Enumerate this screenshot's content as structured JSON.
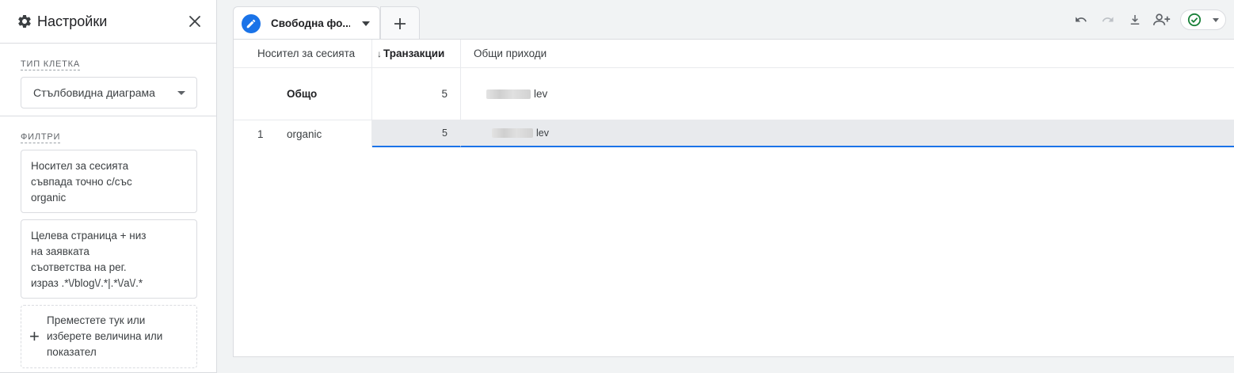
{
  "settings": {
    "title": "Настройки",
    "cell_type_label": "ТИП КЛЕТКА",
    "cell_type_value": "Стълбовидна диаграма",
    "filters_label": "ФИЛТРИ",
    "filters": [
      "Носител за сесията\nсъвпада точно с/със\norganic",
      "Целева страница + низ\nна заявката\nсъответства на рег.\nизраз .*\\/blog\\/.*|.*\\/a\\/.*"
    ],
    "drop_zone_text": "Преместете тук или\nизберете величина или\nпоказател"
  },
  "tab": {
    "label": "Свободна фо..."
  },
  "table": {
    "columns": [
      "Носител за сесията",
      "Транзакции",
      "Общи приходи"
    ],
    "sort_arrow": "↓",
    "total": {
      "label": "Общо",
      "transactions": "5",
      "revenue_suffix": "lev"
    },
    "rows": [
      {
        "index": "1",
        "medium": "organic",
        "transactions": "5",
        "revenue_suffix": "lev"
      }
    ]
  },
  "colors": {
    "accent": "#1a73e8",
    "status_green": "#188038"
  }
}
